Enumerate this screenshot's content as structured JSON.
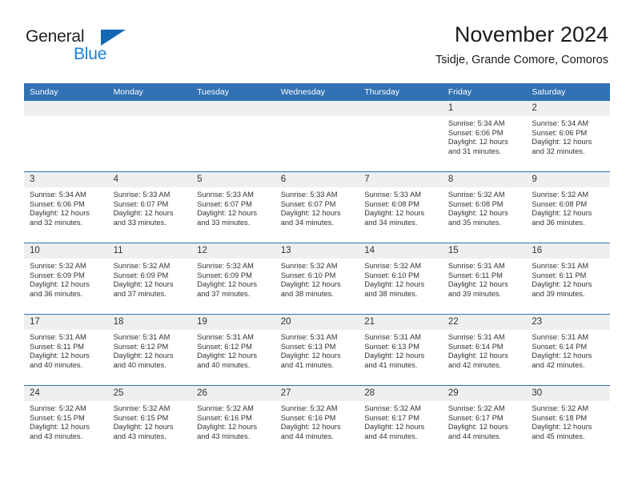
{
  "logo": {
    "word_top": "General",
    "word_bottom": "Blue",
    "triangle_icon": "blue-triangle-icon",
    "color_dark": "#231f20",
    "color_blue": "#1b7fd4"
  },
  "header": {
    "title": "November 2024",
    "subtitle": "Tsidje, Grande Comore, Comoros"
  },
  "theme": {
    "header_blue": "#3171b4",
    "daynum_band": "#efefef",
    "text": "#333333"
  },
  "calendar": {
    "weekday_headers": [
      "Sunday",
      "Monday",
      "Tuesday",
      "Wednesday",
      "Thursday",
      "Friday",
      "Saturday"
    ],
    "weeks": [
      [
        {
          "day": "",
          "empty": true
        },
        {
          "day": "",
          "empty": true
        },
        {
          "day": "",
          "empty": true
        },
        {
          "day": "",
          "empty": true
        },
        {
          "day": "",
          "empty": true
        },
        {
          "day": "1",
          "sunrise": "Sunrise: 5:34 AM",
          "sunset": "Sunset: 6:06 PM",
          "daylight": "Daylight: 12 hours and 31 minutes."
        },
        {
          "day": "2",
          "sunrise": "Sunrise: 5:34 AM",
          "sunset": "Sunset: 6:06 PM",
          "daylight": "Daylight: 12 hours and 32 minutes."
        }
      ],
      [
        {
          "day": "3",
          "sunrise": "Sunrise: 5:34 AM",
          "sunset": "Sunset: 6:06 PM",
          "daylight": "Daylight: 12 hours and 32 minutes."
        },
        {
          "day": "4",
          "sunrise": "Sunrise: 5:33 AM",
          "sunset": "Sunset: 6:07 PM",
          "daylight": "Daylight: 12 hours and 33 minutes."
        },
        {
          "day": "5",
          "sunrise": "Sunrise: 5:33 AM",
          "sunset": "Sunset: 6:07 PM",
          "daylight": "Daylight: 12 hours and 33 minutes."
        },
        {
          "day": "6",
          "sunrise": "Sunrise: 5:33 AM",
          "sunset": "Sunset: 6:07 PM",
          "daylight": "Daylight: 12 hours and 34 minutes."
        },
        {
          "day": "7",
          "sunrise": "Sunrise: 5:33 AM",
          "sunset": "Sunset: 6:08 PM",
          "daylight": "Daylight: 12 hours and 34 minutes."
        },
        {
          "day": "8",
          "sunrise": "Sunrise: 5:32 AM",
          "sunset": "Sunset: 6:08 PM",
          "daylight": "Daylight: 12 hours and 35 minutes."
        },
        {
          "day": "9",
          "sunrise": "Sunrise: 5:32 AM",
          "sunset": "Sunset: 6:08 PM",
          "daylight": "Daylight: 12 hours and 36 minutes."
        }
      ],
      [
        {
          "day": "10",
          "sunrise": "Sunrise: 5:32 AM",
          "sunset": "Sunset: 6:09 PM",
          "daylight": "Daylight: 12 hours and 36 minutes."
        },
        {
          "day": "11",
          "sunrise": "Sunrise: 5:32 AM",
          "sunset": "Sunset: 6:09 PM",
          "daylight": "Daylight: 12 hours and 37 minutes."
        },
        {
          "day": "12",
          "sunrise": "Sunrise: 5:32 AM",
          "sunset": "Sunset: 6:09 PM",
          "daylight": "Daylight: 12 hours and 37 minutes."
        },
        {
          "day": "13",
          "sunrise": "Sunrise: 5:32 AM",
          "sunset": "Sunset: 6:10 PM",
          "daylight": "Daylight: 12 hours and 38 minutes."
        },
        {
          "day": "14",
          "sunrise": "Sunrise: 5:32 AM",
          "sunset": "Sunset: 6:10 PM",
          "daylight": "Daylight: 12 hours and 38 minutes."
        },
        {
          "day": "15",
          "sunrise": "Sunrise: 5:31 AM",
          "sunset": "Sunset: 6:11 PM",
          "daylight": "Daylight: 12 hours and 39 minutes."
        },
        {
          "day": "16",
          "sunrise": "Sunrise: 5:31 AM",
          "sunset": "Sunset: 6:11 PM",
          "daylight": "Daylight: 12 hours and 39 minutes."
        }
      ],
      [
        {
          "day": "17",
          "sunrise": "Sunrise: 5:31 AM",
          "sunset": "Sunset: 6:11 PM",
          "daylight": "Daylight: 12 hours and 40 minutes."
        },
        {
          "day": "18",
          "sunrise": "Sunrise: 5:31 AM",
          "sunset": "Sunset: 6:12 PM",
          "daylight": "Daylight: 12 hours and 40 minutes."
        },
        {
          "day": "19",
          "sunrise": "Sunrise: 5:31 AM",
          "sunset": "Sunset: 6:12 PM",
          "daylight": "Daylight: 12 hours and 40 minutes."
        },
        {
          "day": "20",
          "sunrise": "Sunrise: 5:31 AM",
          "sunset": "Sunset: 6:13 PM",
          "daylight": "Daylight: 12 hours and 41 minutes."
        },
        {
          "day": "21",
          "sunrise": "Sunrise: 5:31 AM",
          "sunset": "Sunset: 6:13 PM",
          "daylight": "Daylight: 12 hours and 41 minutes."
        },
        {
          "day": "22",
          "sunrise": "Sunrise: 5:31 AM",
          "sunset": "Sunset: 6:14 PM",
          "daylight": "Daylight: 12 hours and 42 minutes."
        },
        {
          "day": "23",
          "sunrise": "Sunrise: 5:31 AM",
          "sunset": "Sunset: 6:14 PM",
          "daylight": "Daylight: 12 hours and 42 minutes."
        }
      ],
      [
        {
          "day": "24",
          "sunrise": "Sunrise: 5:32 AM",
          "sunset": "Sunset: 6:15 PM",
          "daylight": "Daylight: 12 hours and 43 minutes."
        },
        {
          "day": "25",
          "sunrise": "Sunrise: 5:32 AM",
          "sunset": "Sunset: 6:15 PM",
          "daylight": "Daylight: 12 hours and 43 minutes."
        },
        {
          "day": "26",
          "sunrise": "Sunrise: 5:32 AM",
          "sunset": "Sunset: 6:16 PM",
          "daylight": "Daylight: 12 hours and 43 minutes."
        },
        {
          "day": "27",
          "sunrise": "Sunrise: 5:32 AM",
          "sunset": "Sunset: 6:16 PM",
          "daylight": "Daylight: 12 hours and 44 minutes."
        },
        {
          "day": "28",
          "sunrise": "Sunrise: 5:32 AM",
          "sunset": "Sunset: 6:17 PM",
          "daylight": "Daylight: 12 hours and 44 minutes."
        },
        {
          "day": "29",
          "sunrise": "Sunrise: 5:32 AM",
          "sunset": "Sunset: 6:17 PM",
          "daylight": "Daylight: 12 hours and 44 minutes."
        },
        {
          "day": "30",
          "sunrise": "Sunrise: 5:32 AM",
          "sunset": "Sunset: 6:18 PM",
          "daylight": "Daylight: 12 hours and 45 minutes."
        }
      ]
    ]
  }
}
